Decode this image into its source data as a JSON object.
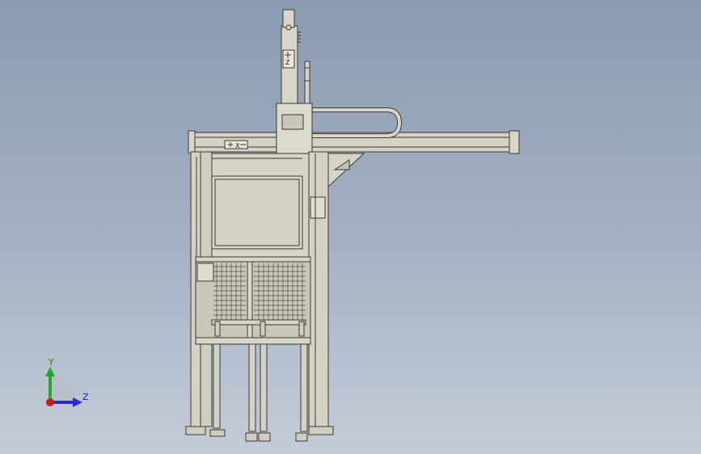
{
  "viewport": {
    "background_top": "#8b9bb3",
    "background_bottom": "#c5ccd8",
    "model_color": "#d8d6c8",
    "edge_color": "#3a3a36"
  },
  "triad": {
    "y_label": "Y",
    "z_label": "Z",
    "y_color": "#1fae2a",
    "z_color": "#2a2ae0",
    "origin_color": "#d01a1a"
  },
  "model": {
    "plate_z_label": "Z",
    "plate_x_label": "X"
  }
}
